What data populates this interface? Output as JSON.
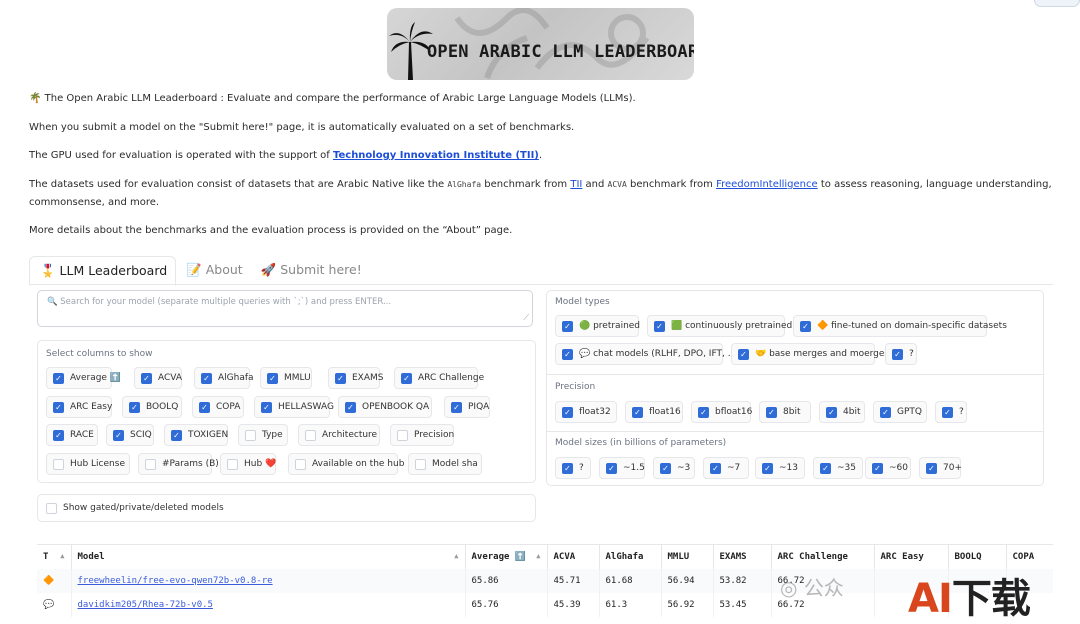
{
  "logo": {
    "text": "OPEN ARABIC LLM LEADERBOARD"
  },
  "intro": {
    "line1": "🌴 The Open Arabic LLM Leaderboard : Evaluate and compare the performance of Arabic Large Language Models (LLMs).",
    "line2": "When you submit a model on the \"Submit here!\" page, it is automatically evaluated on a set of benchmarks.",
    "line3_prefix": "The GPU used for evaluation is operated with the support of ",
    "line3_link": "Technology Innovation Institute (TII)",
    "line3_suffix": ".",
    "line4_a": "The datasets used for evaluation consist of datasets that are Arabic Native like the ",
    "line4_code1": "AlGhafa",
    "line4_b": " benchmark from ",
    "line4_link1": "TII",
    "line4_c": " and ",
    "line4_code2": "ACVA",
    "line4_d": " benchmark from ",
    "line4_link2": "FreedomIntelligence",
    "line4_e": " to assess reasoning, language understanding, commonsense, and more.",
    "line5": "More details about the benchmarks and the evaluation process is provided on the “About” page."
  },
  "tabs": [
    {
      "label": "🎖️ LLM Leaderboard"
    },
    {
      "label": "📝 About"
    },
    {
      "label": "🚀 Submit here!"
    }
  ],
  "search": {
    "placeholder": "🔍 Search for your model (separate multiple queries with `;`) and press ENTER..."
  },
  "columns_panel": {
    "label": "Select columns to show",
    "items": [
      {
        "label": "Average ⬆️",
        "checked": true
      },
      {
        "label": "ACVA",
        "checked": true
      },
      {
        "label": "AlGhafa",
        "checked": true
      },
      {
        "label": "MMLU",
        "checked": true
      },
      {
        "label": "EXAMS",
        "checked": true
      },
      {
        "label": "ARC Challenge",
        "checked": true
      },
      {
        "label": "ARC Easy",
        "checked": true
      },
      {
        "label": "BOOLQ",
        "checked": true
      },
      {
        "label": "COPA",
        "checked": true
      },
      {
        "label": "HELLASWAG",
        "checked": true
      },
      {
        "label": "OPENBOOK QA",
        "checked": true
      },
      {
        "label": "PIQA",
        "checked": true
      },
      {
        "label": "RACE",
        "checked": true
      },
      {
        "label": "SCIQ",
        "checked": true
      },
      {
        "label": "TOXIGEN",
        "checked": true
      },
      {
        "label": "Type",
        "checked": false
      },
      {
        "label": "Architecture",
        "checked": false
      },
      {
        "label": "Precision",
        "checked": false
      },
      {
        "label": "Hub License",
        "checked": false
      },
      {
        "label": "#Params (B)",
        "checked": false
      },
      {
        "label": "Hub ❤️",
        "checked": false
      },
      {
        "label": "Available on the hub",
        "checked": false
      },
      {
        "label": "Model sha",
        "checked": false
      }
    ]
  },
  "gated": {
    "label": "Show gated/private/deleted models",
    "checked": false
  },
  "model_types": {
    "label": "Model types",
    "items": [
      {
        "label": "🟢 pretrained",
        "checked": true
      },
      {
        "label": "🟩 continuously pretrained",
        "checked": true
      },
      {
        "label": "🔶 fine-tuned on domain-specific datasets",
        "checked": true
      },
      {
        "label": "💬 chat models (RLHF, DPO, IFT, ...)",
        "checked": true
      },
      {
        "label": "🤝 base merges and moerges",
        "checked": true
      },
      {
        "label": "?",
        "checked": true
      }
    ]
  },
  "precision": {
    "label": "Precision",
    "items": [
      {
        "label": "float32",
        "checked": true
      },
      {
        "label": "float16",
        "checked": true
      },
      {
        "label": "bfloat16",
        "checked": true
      },
      {
        "label": "8bit",
        "checked": true
      },
      {
        "label": "4bit",
        "checked": true
      },
      {
        "label": "GPTQ",
        "checked": true
      },
      {
        "label": "?",
        "checked": true
      }
    ]
  },
  "model_sizes": {
    "label": "Model sizes (in billions of parameters)",
    "items": [
      {
        "label": "?",
        "checked": true
      },
      {
        "label": "~1.5",
        "checked": true
      },
      {
        "label": "~3",
        "checked": true
      },
      {
        "label": "~7",
        "checked": true
      },
      {
        "label": "~13",
        "checked": true
      },
      {
        "label": "~35",
        "checked": true
      },
      {
        "label": "~60",
        "checked": true
      },
      {
        "label": "70+",
        "checked": true
      }
    ]
  },
  "table": {
    "headers": [
      "T",
      "Model",
      "Average ⬆️",
      "ACVA",
      "AlGhafa",
      "MMLU",
      "EXAMS",
      "ARC Challenge",
      "ARC Easy",
      "BOOLQ",
      "COPA"
    ],
    "rows": [
      {
        "type": "🔶",
        "model": "freewheelin/free-evo-qwen72b-v0.8-re",
        "values": [
          "65.86",
          "45.71",
          "61.68",
          "56.94",
          "53.82",
          "66.72",
          "",
          "",
          ""
        ]
      },
      {
        "type": "💬",
        "model": "davidkim205/Rhea-72b-v0.5",
        "values": [
          "65.76",
          "45.39",
          "61.3",
          "56.92",
          "53.45",
          "66.72",
          "",
          "",
          ""
        ]
      }
    ]
  },
  "watermark": {
    "wechat": "公众",
    "ai": "AI",
    "dl": "下载"
  }
}
